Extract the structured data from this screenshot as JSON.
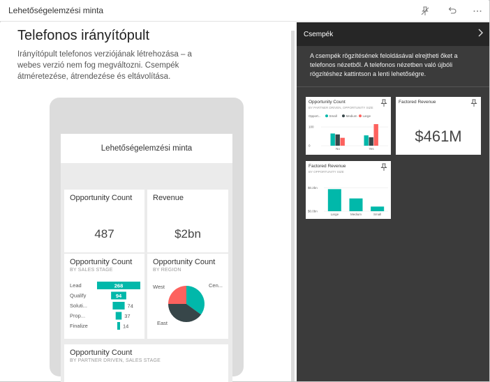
{
  "window": {
    "title": "Lehetőségelemzési minta"
  },
  "left": {
    "heading": "Telefonos irányítópult",
    "description": "Irányítópult telefonos verziójának létrehozása – a webes verzió nem fog megváltozni. Csempék átméretezése, átrendezése és eltávolítása."
  },
  "phone": {
    "dashboard_title": "Lehetőségelemzési minta",
    "tiles": {
      "opp_count": {
        "title": "Opportunity Count",
        "value": "487"
      },
      "revenue": {
        "title": "Revenue",
        "value": "$2bn"
      },
      "by_stage": {
        "title": "Opportunity Count",
        "subtitle": "BY SALES STAGE"
      },
      "by_region": {
        "title": "Opportunity Count",
        "subtitle": "BY REGION"
      },
      "by_partner": {
        "title": "Opportunity Count",
        "subtitle": "BY PARTNER DRIVEN, SALES STAGE"
      }
    }
  },
  "panel": {
    "title": "Csempék",
    "info": "A csempék rögzítésének feloldásával elrejtheti őket a telefonos nézetből. A telefonos nézetben való újbóli rögzítéshez kattintson a lenti lehetőségre.",
    "tiles": {
      "opp_count": {
        "title": "Opportunity Count",
        "subtitle": "BY PARTNER DRIVEN, OPPORTUNITY SIZE"
      },
      "factored": {
        "title": "Factored Revenue",
        "value": "$461M"
      },
      "factored_size": {
        "title": "Factored Revenue",
        "subtitle": "BY OPPORTUNITY SIZE"
      }
    }
  },
  "chart_data": [
    {
      "type": "bar",
      "chart": "funnel",
      "categories": [
        "Lead",
        "Qualify",
        "Soluti...",
        "Prop...",
        "Finalize"
      ],
      "values": [
        268,
        94,
        74,
        37,
        14
      ],
      "color": "#01b8aa"
    },
    {
      "type": "pie",
      "categories": [
        "West",
        "Cen...",
        "East"
      ],
      "values": [
        35,
        40,
        25
      ],
      "colors": [
        "#01b8aa",
        "#374649",
        "#fd625e"
      ]
    },
    {
      "type": "bar",
      "legend": [
        "Opport...",
        "Small",
        "Medium",
        "Large"
      ],
      "series": [
        {
          "name": "Small",
          "values": [
            65,
            55
          ],
          "color": "#01b8aa"
        },
        {
          "name": "Medium",
          "values": [
            60,
            45
          ],
          "color": "#374649"
        },
        {
          "name": "Large",
          "values": [
            42,
            115
          ],
          "color": "#fd625e"
        }
      ],
      "categories": [
        "No",
        "Yes"
      ],
      "yticks": [
        "100",
        "0"
      ],
      "ylim": [
        0,
        130
      ]
    },
    {
      "type": "bar",
      "categories": [
        "Large",
        "Medium",
        "Small"
      ],
      "values": [
        0.19,
        0.11,
        0.04
      ],
      "yticks": [
        "$0.2bn",
        "$0.0bn"
      ],
      "ylim": [
        0,
        0.24
      ],
      "color": "#01b8aa"
    }
  ]
}
